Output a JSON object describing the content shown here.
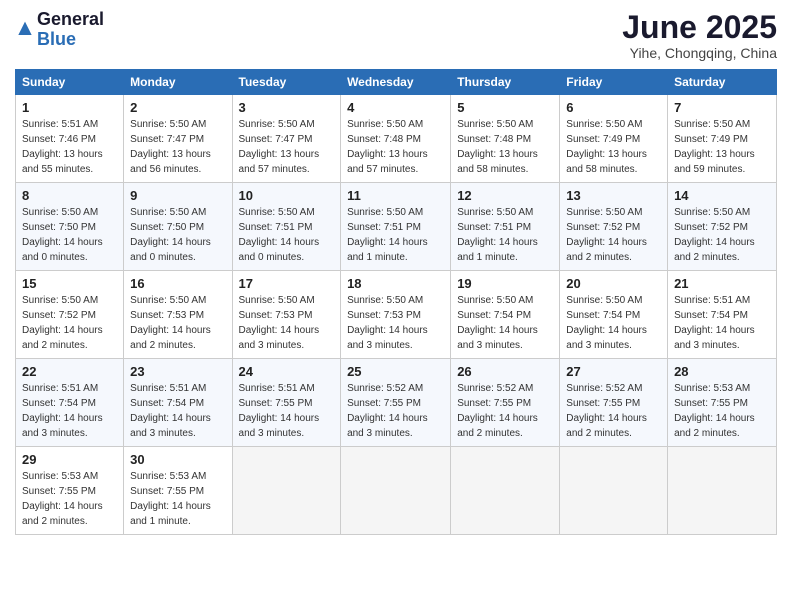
{
  "header": {
    "logo_general": "General",
    "logo_blue": "Blue",
    "month_year": "June 2025",
    "location": "Yihe, Chongqing, China"
  },
  "weekdays": [
    "Sunday",
    "Monday",
    "Tuesday",
    "Wednesday",
    "Thursday",
    "Friday",
    "Saturday"
  ],
  "weeks": [
    [
      {
        "day": "1",
        "sunrise": "5:51 AM",
        "sunset": "7:46 PM",
        "daylight": "13 hours and 55 minutes."
      },
      {
        "day": "2",
        "sunrise": "5:50 AM",
        "sunset": "7:47 PM",
        "daylight": "13 hours and 56 minutes."
      },
      {
        "day": "3",
        "sunrise": "5:50 AM",
        "sunset": "7:47 PM",
        "daylight": "13 hours and 57 minutes."
      },
      {
        "day": "4",
        "sunrise": "5:50 AM",
        "sunset": "7:48 PM",
        "daylight": "13 hours and 57 minutes."
      },
      {
        "day": "5",
        "sunrise": "5:50 AM",
        "sunset": "7:48 PM",
        "daylight": "13 hours and 58 minutes."
      },
      {
        "day": "6",
        "sunrise": "5:50 AM",
        "sunset": "7:49 PM",
        "daylight": "13 hours and 58 minutes."
      },
      {
        "day": "7",
        "sunrise": "5:50 AM",
        "sunset": "7:49 PM",
        "daylight": "13 hours and 59 minutes."
      }
    ],
    [
      {
        "day": "8",
        "sunrise": "5:50 AM",
        "sunset": "7:50 PM",
        "daylight": "14 hours and 0 minutes."
      },
      {
        "day": "9",
        "sunrise": "5:50 AM",
        "sunset": "7:50 PM",
        "daylight": "14 hours and 0 minutes."
      },
      {
        "day": "10",
        "sunrise": "5:50 AM",
        "sunset": "7:51 PM",
        "daylight": "14 hours and 0 minutes."
      },
      {
        "day": "11",
        "sunrise": "5:50 AM",
        "sunset": "7:51 PM",
        "daylight": "14 hours and 1 minute."
      },
      {
        "day": "12",
        "sunrise": "5:50 AM",
        "sunset": "7:51 PM",
        "daylight": "14 hours and 1 minute."
      },
      {
        "day": "13",
        "sunrise": "5:50 AM",
        "sunset": "7:52 PM",
        "daylight": "14 hours and 2 minutes."
      },
      {
        "day": "14",
        "sunrise": "5:50 AM",
        "sunset": "7:52 PM",
        "daylight": "14 hours and 2 minutes."
      }
    ],
    [
      {
        "day": "15",
        "sunrise": "5:50 AM",
        "sunset": "7:52 PM",
        "daylight": "14 hours and 2 minutes."
      },
      {
        "day": "16",
        "sunrise": "5:50 AM",
        "sunset": "7:53 PM",
        "daylight": "14 hours and 2 minutes."
      },
      {
        "day": "17",
        "sunrise": "5:50 AM",
        "sunset": "7:53 PM",
        "daylight": "14 hours and 3 minutes."
      },
      {
        "day": "18",
        "sunrise": "5:50 AM",
        "sunset": "7:53 PM",
        "daylight": "14 hours and 3 minutes."
      },
      {
        "day": "19",
        "sunrise": "5:50 AM",
        "sunset": "7:54 PM",
        "daylight": "14 hours and 3 minutes."
      },
      {
        "day": "20",
        "sunrise": "5:50 AM",
        "sunset": "7:54 PM",
        "daylight": "14 hours and 3 minutes."
      },
      {
        "day": "21",
        "sunrise": "5:51 AM",
        "sunset": "7:54 PM",
        "daylight": "14 hours and 3 minutes."
      }
    ],
    [
      {
        "day": "22",
        "sunrise": "5:51 AM",
        "sunset": "7:54 PM",
        "daylight": "14 hours and 3 minutes."
      },
      {
        "day": "23",
        "sunrise": "5:51 AM",
        "sunset": "7:54 PM",
        "daylight": "14 hours and 3 minutes."
      },
      {
        "day": "24",
        "sunrise": "5:51 AM",
        "sunset": "7:55 PM",
        "daylight": "14 hours and 3 minutes."
      },
      {
        "day": "25",
        "sunrise": "5:52 AM",
        "sunset": "7:55 PM",
        "daylight": "14 hours and 3 minutes."
      },
      {
        "day": "26",
        "sunrise": "5:52 AM",
        "sunset": "7:55 PM",
        "daylight": "14 hours and 2 minutes."
      },
      {
        "day": "27",
        "sunrise": "5:52 AM",
        "sunset": "7:55 PM",
        "daylight": "14 hours and 2 minutes."
      },
      {
        "day": "28",
        "sunrise": "5:53 AM",
        "sunset": "7:55 PM",
        "daylight": "14 hours and 2 minutes."
      }
    ],
    [
      {
        "day": "29",
        "sunrise": "5:53 AM",
        "sunset": "7:55 PM",
        "daylight": "14 hours and 2 minutes."
      },
      {
        "day": "30",
        "sunrise": "5:53 AM",
        "sunset": "7:55 PM",
        "daylight": "14 hours and 1 minute."
      },
      null,
      null,
      null,
      null,
      null
    ]
  ]
}
